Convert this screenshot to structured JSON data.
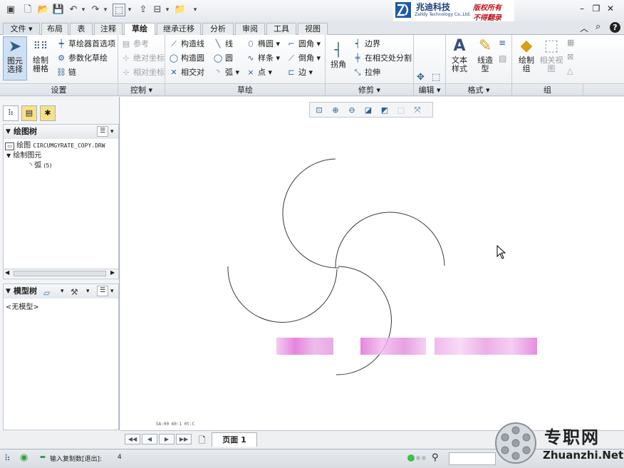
{
  "quick_access": {
    "dropdown": "▾"
  },
  "logo": {
    "company_cn": "兆迪科技",
    "company_en": "Zalldy Technology Co.,Ltd.",
    "copyright_1": "版权所有",
    "copyright_2": "不得翻录"
  },
  "tabs": [
    {
      "label": "文件"
    },
    {
      "label": "布局"
    },
    {
      "label": "表"
    },
    {
      "label": "注释"
    },
    {
      "label": "草绘"
    },
    {
      "label": "继承迁移"
    },
    {
      "label": "分析"
    },
    {
      "label": "审阅"
    },
    {
      "label": "工具"
    },
    {
      "label": "视图"
    }
  ],
  "ribbon": {
    "select_l1": "图元",
    "select_l2": "选择",
    "grid_l1": "绘制",
    "grid_l2": "栅格",
    "sketcher_prefs": "草绘器首选项",
    "param_sketch": "参数化草绘",
    "chain": "链",
    "reference": "参考",
    "abs_coord": "绝对坐标",
    "rel_coord": "相对坐标",
    "construction_line": "构造线",
    "construction_circle": "构造圆",
    "intersect": "相交对",
    "line": "线",
    "circle": "圆",
    "arc": "弧",
    "ellipse": "椭圆",
    "spline": "样条",
    "point": "点",
    "fillet": "圆角",
    "chamfer": "倒角",
    "edge": "边",
    "corner": "拐角",
    "boundary": "边界",
    "split_intersect": "在相交处分割",
    "stretch": "拉伸",
    "text_l1": "文本",
    "text_l2": "样式",
    "linetype_l1": "线造",
    "linetype_l2": "型",
    "draw_group_l1": "绘制",
    "draw_group_l2": "组",
    "related_view_l1": "相关视",
    "related_view_l2": "图"
  },
  "groups": [
    {
      "label": "设置"
    },
    {
      "label": "控制 ▾"
    },
    {
      "label": "草绘"
    },
    {
      "label": "修剪 ▾"
    },
    {
      "label": "编辑 ▾"
    },
    {
      "label": "格式 ▾"
    },
    {
      "label": "组"
    }
  ],
  "drawing_tree": {
    "title": "绘图树",
    "root_prefix": "绘图",
    "root_name": "CIRCUMGYRATE_COPY.DRW",
    "child": "绘制图元",
    "arc_item": "弧",
    "arc_count": "(5)"
  },
  "model_tree": {
    "title": "模型树",
    "empty": "<无模型>"
  },
  "page_bar": {
    "page_label": "页面 1"
  },
  "canvas": {
    "coord_readout": "SA:00  60:1  0t:C"
  },
  "status_bar": {
    "prompt": "输入复制数[退出]:",
    "value": "4"
  },
  "watermark": {
    "text_cn": "专职网",
    "text_en": "Zhuanzhi.Net"
  },
  "colors": {
    "accent": "#2b5e8e",
    "blur_pink": "#e070d8"
  }
}
